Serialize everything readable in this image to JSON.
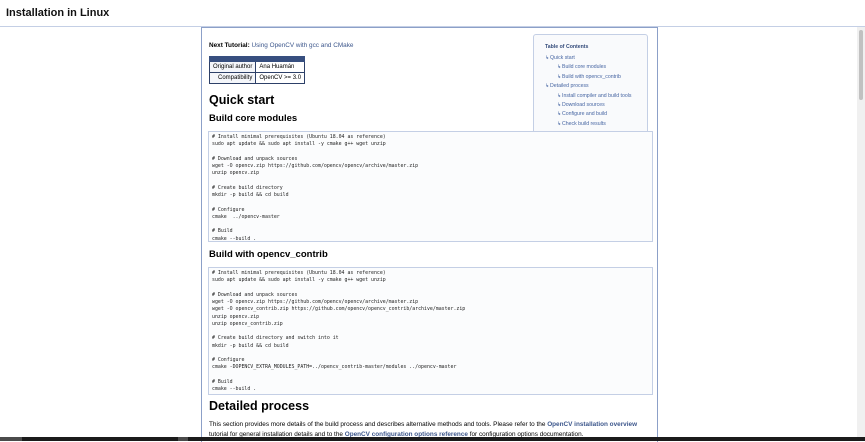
{
  "header": {
    "title": "Installation in Linux"
  },
  "next_tutorial": {
    "label": "Next Tutorial:",
    "link": "Using OpenCV with gcc and CMake"
  },
  "info_table": [
    {
      "key": "Original author",
      "value": "Ana Huamán"
    },
    {
      "key": "Compatibility",
      "value": "OpenCV >= 3.0"
    }
  ],
  "toc": {
    "title": "Table of Contents",
    "items": [
      {
        "label": "Quick start",
        "level": 1
      },
      {
        "label": "Build core modules",
        "level": 2
      },
      {
        "label": "Build with opencv_contrib",
        "level": 2
      },
      {
        "label": "Detailed process",
        "level": 1
      },
      {
        "label": "Install compiler and build tools",
        "level": 2
      },
      {
        "label": "Download sources",
        "level": 2
      },
      {
        "label": "Configure and build",
        "level": 2
      },
      {
        "label": "Check build results",
        "level": 2
      }
    ]
  },
  "sections": {
    "quick_start": "Quick start",
    "build_core": "Build core modules",
    "build_contrib": "Build with opencv_contrib",
    "detailed": "Detailed process"
  },
  "code_core": "# Install minimal prerequisites (Ubuntu 18.04 as reference)\nsudo apt update && sudo apt install -y cmake g++ wget unzip\n\n# Download and unpack sources\nwget -O opencv.zip https://github.com/opencv/opencv/archive/master.zip\nunzip opencv.zip\n\n# Create build directory\nmkdir -p build && cd build\n\n# Configure\ncmake  ../opencv-master\n\n# Build\ncmake --build .",
  "code_contrib": "# Install minimal prerequisites (Ubuntu 18.04 as reference)\nsudo apt update && sudo apt install -y cmake g++ wget unzip\n\n# Download and unpack sources\nwget -O opencv.zip https://github.com/opencv/opencv/archive/master.zip\nwget -O opencv_contrib.zip https://github.com/opencv/opencv_contrib/archive/master.zip\nunzip opencv.zip\nunzip opencv_contrib.zip\n\n# Create build directory and switch into it\nmkdir -p build && cd build\n\n# Configure\ncmake -DOPENCV_EXTRA_MODULES_PATH=../opencv_contrib-master/modules ../opencv-master\n\n# Build\ncmake --build .",
  "detailed_para": {
    "t1": "This section provides more details of the build process and describes alternative methods and tools. Please refer to the ",
    "l1": "OpenCV installation overview",
    "t2": " tutorial for general installation details and to the ",
    "l2": "OpenCV configuration options reference",
    "t3": " for configuration options documentation."
  },
  "colors": {
    "link": "#3d578c",
    "table_header": "#374f7f",
    "border": "#c4cfe5"
  }
}
